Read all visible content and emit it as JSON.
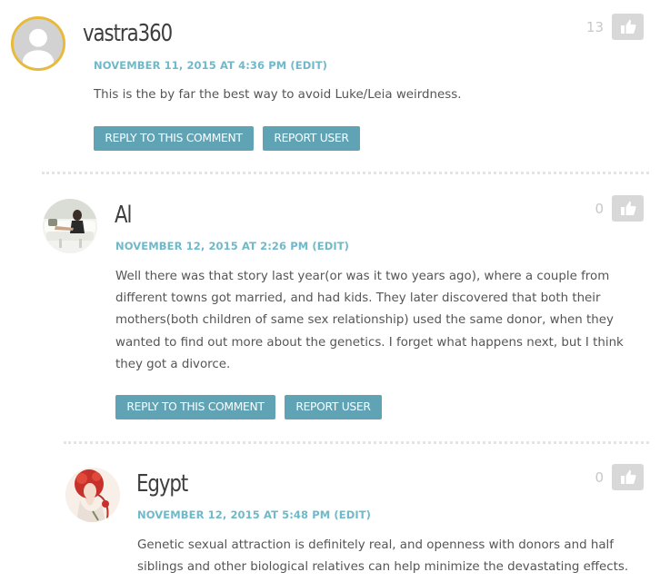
{
  "comments": [
    {
      "author": "vastra360",
      "date": "NOVEMBER 11, 2015 AT 4:36 PM",
      "edit": "(EDIT)",
      "text": "This is the by far the best way to avoid Luke/Leia weirdness.",
      "reply_label": "REPLY TO THIS COMMENT",
      "report_label": "REPORT USER",
      "likes": "13",
      "avatar_icon": "default-user-icon"
    },
    {
      "author": "Al",
      "date": "NOVEMBER 12, 2015 AT 2:26 PM",
      "edit": "(EDIT)",
      "lines": [
        "Well there was that story last year(or was it two years ago), where a couple from",
        "different towns got married, and had kids. They later discovered that both their",
        "mothers(both children of same sex relationship) used the same donor, when they",
        "wanted to find out more about the genetics. I forget what happens next, but I think",
        "they got a divorce."
      ],
      "reply_label": "REPLY TO THIS COMMENT",
      "report_label": "REPORT USER",
      "likes": "0",
      "avatar_icon": "photo-avatar"
    },
    {
      "author": "Egypt",
      "date": "NOVEMBER 12, 2015 AT 5:48 PM",
      "edit": "(EDIT)",
      "lines": [
        "Genetic sexual attraction is definitely real, and openness with donors and half",
        "siblings and other biological relatives can help minimize the devastating effects."
      ],
      "likes": "0",
      "avatar_icon": "illustration-avatar"
    }
  ],
  "colors": {
    "accent": "#6fb9c9",
    "button": "#5fa3b4",
    "avatar_ring": "#e8b93a",
    "like_bg": "#d8d8d8"
  }
}
